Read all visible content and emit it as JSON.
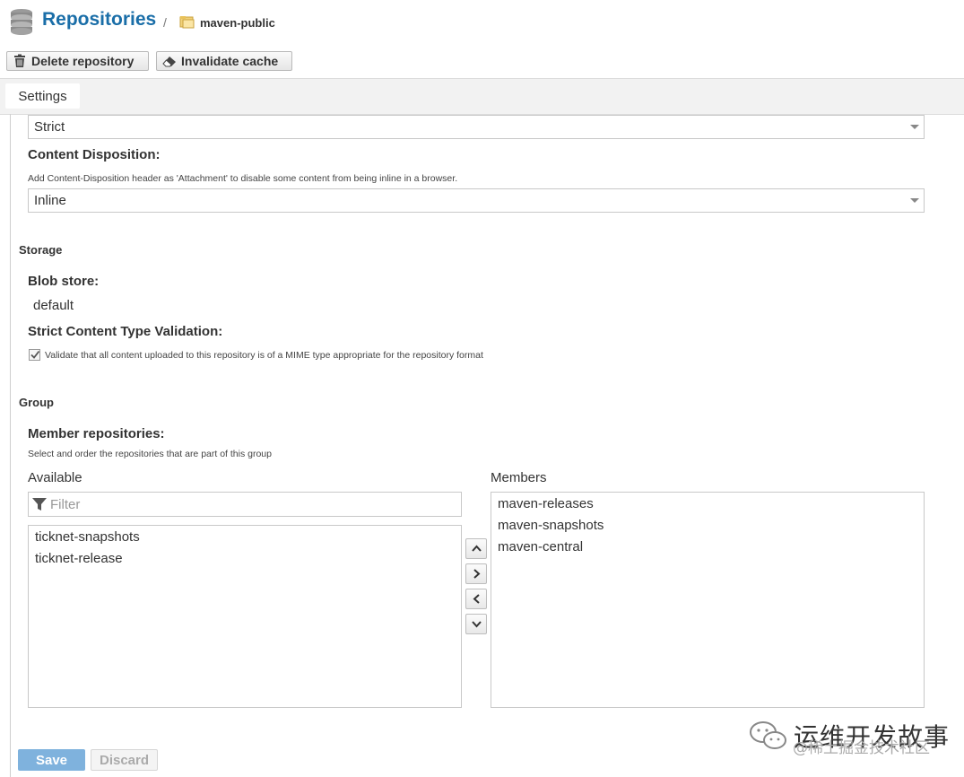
{
  "header": {
    "title": "Repositories",
    "separator": "/",
    "repo_name": "maven-public",
    "icons": [
      "database-icon",
      "repository-group-icon"
    ]
  },
  "toolbar": {
    "delete_label": "Delete repository",
    "invalidate_label": "Invalidate cache"
  },
  "tabs": [
    {
      "label": "Settings"
    }
  ],
  "form": {
    "strict_value": "Strict",
    "content_disposition": {
      "label": "Content Disposition:",
      "help": "Add Content-Disposition header as 'Attachment' to disable some content from being inline in a browser.",
      "value": "Inline"
    },
    "storage": {
      "section": "Storage",
      "blob_store_label": "Blob store:",
      "blob_store_value": "default",
      "strict_validation_label": "Strict Content Type Validation:",
      "strict_validation_checked": true,
      "strict_validation_text": "Validate that all content uploaded to this repository is of a MIME type appropriate for the repository format"
    },
    "group": {
      "section": "Group",
      "members_label": "Member repositories:",
      "members_help": "Select and order the repositories that are part of this group",
      "available_label": "Available",
      "members_title": "Members",
      "filter_placeholder": "Filter",
      "available": [
        "ticknet-snapshots",
        "ticknet-release"
      ],
      "members": [
        "maven-releases",
        "maven-snapshots",
        "maven-central"
      ]
    },
    "save_label": "Save",
    "discard_label": "Discard"
  },
  "watermark": {
    "line1": "运维开发故事",
    "line2": "@稀土掘金技术社区"
  },
  "colors": {
    "title": "#1a6ea8",
    "save_button": "#7fb2dd"
  }
}
